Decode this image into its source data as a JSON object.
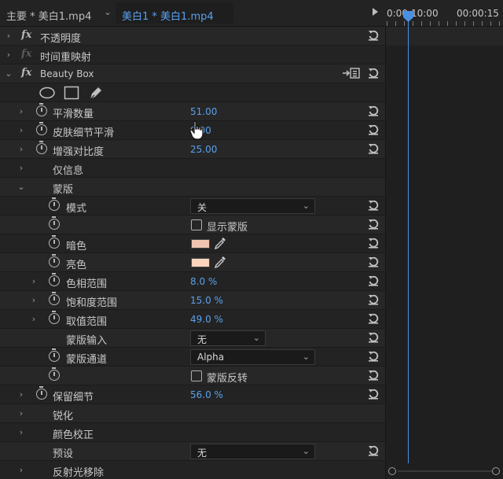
{
  "header": {
    "source_label": "主要 * 美白1.mp4",
    "sequence_tab": "美白1 * 美白1.mp4",
    "timecode_start": "0:00:10:00",
    "timecode_end": "00:00:15"
  },
  "effects": {
    "opacity_label": "不透明度",
    "time_remap_label": "时间重映射",
    "beauty_box_label": "Beauty Box",
    "fx_label": "fx"
  },
  "params": {
    "smoothing_label": "平滑数量",
    "smoothing_value": "51.00",
    "skin_detail_label": "皮肤细节平滑",
    "skin_detail_value": "9.00",
    "contrast_label": "增强对比度",
    "contrast_value": "25.00",
    "info_only_label": "仅信息",
    "mask_label": "蒙版",
    "mode_label": "模式",
    "mode_value": "关",
    "show_mask_label": "显示蒙版",
    "dark_label": "暗色",
    "dark_color": "#f0c4b0",
    "light_label": "亮色",
    "light_color": "#fad4bc",
    "hue_range_label": "色相范围",
    "hue_range_value": "8.0 %",
    "sat_range_label": "饱和度范围",
    "sat_range_value": "15.0 %",
    "val_range_label": "取值范围",
    "val_range_value": "49.0 %",
    "mask_input_label": "蒙版输入",
    "mask_input_value": "无",
    "mask_channel_label": "蒙版通道",
    "mask_channel_value": "Alpha",
    "invert_mask_label": "蒙版反转",
    "preserve_detail_label": "保留细节",
    "preserve_detail_value": "56.0 %",
    "sharpen_label": "锐化",
    "color_correct_label": "颜色校正",
    "preset_label": "预设",
    "preset_value": "无",
    "reflect_remove_label": "反射光移除"
  },
  "colors": {
    "accent_blue": "#5aa0ec",
    "panel_bg": "#232323",
    "playhead": "#4a90e2"
  },
  "icons": [
    "reset-icon",
    "stopwatch-icon",
    "fx-icon",
    "ellipse-mask-icon",
    "rectangle-mask-icon",
    "pen-mask-icon",
    "eyedropper-icon",
    "export-icon",
    "hand-cursor-icon",
    "play-icon"
  ]
}
